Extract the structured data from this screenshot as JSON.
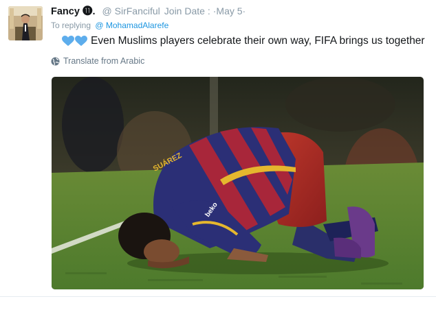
{
  "tweet": {
    "author": {
      "name": "Fancy",
      "badge": "⓫.",
      "handle": "@ SirFanciful",
      "join_label": "Join Date :",
      "date": "May 5"
    },
    "reply": {
      "label": "To replying",
      "mention": "@ MohamadAlarefe"
    },
    "text": "Even Muslims players celebrate their own way, FIFA brings us together",
    "emojis": [
      "blue-heart",
      "blue-heart"
    ],
    "translate_label": "Translate from Arabic",
    "media": {
      "shirt_name": "SUÁREZ",
      "sponsor": "beko"
    }
  },
  "colors": {
    "name": "#14171a",
    "meta": "#8899a6",
    "mention": "#1b95e0",
    "heart": "#5dadec",
    "pitch": "#4d7a2c"
  }
}
